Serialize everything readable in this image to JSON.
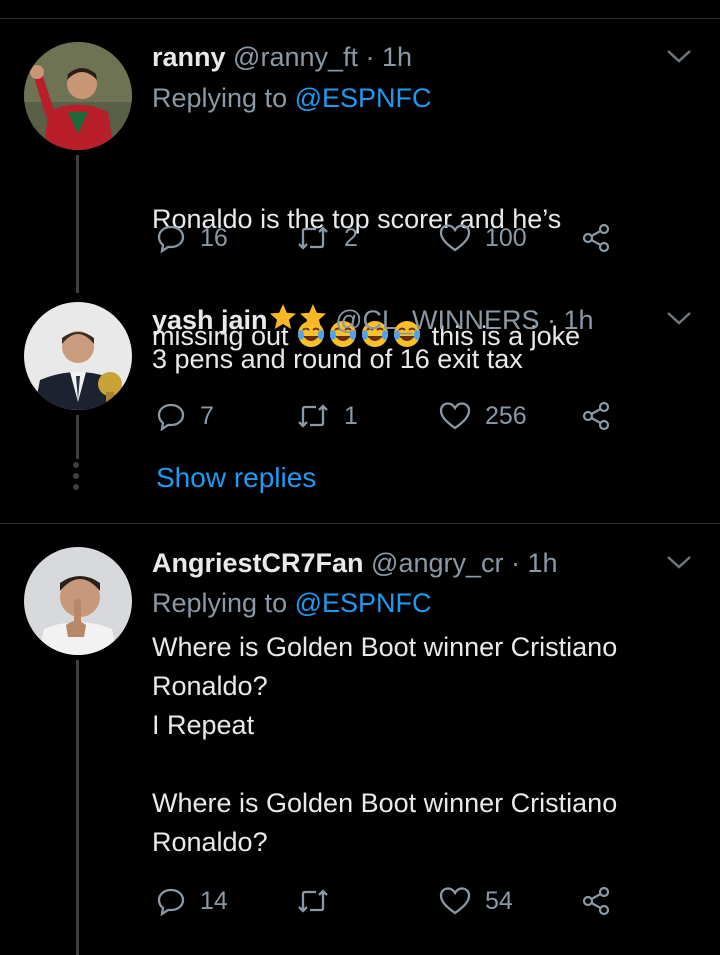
{
  "tweets": [
    {
      "name": "ranny",
      "handle": "@ranny_ft",
      "time": "· 1h",
      "replying_prefix": "Replying to",
      "replying_to": "@ESPNFC",
      "text_line1": "Ronaldo is the top scorer and he’s",
      "text_line2_before": "missing out",
      "text_line2_after": "this is a joke",
      "emoji": "face-with-tears-of-joy-icon x4",
      "replies": "16",
      "retweets": "2",
      "likes": "100"
    },
    {
      "name": "yash jain",
      "name_badges": "star-icon x2",
      "handle": "@CL_WINNERS",
      "time": "· 1h",
      "text": "3 pens and round of 16 exit tax",
      "replies": "7",
      "retweets": "1",
      "likes": "256",
      "show_replies": "Show replies"
    },
    {
      "name": "AngriestCR7Fan",
      "handle": "@angry_cr",
      "time": "· 1h",
      "replying_prefix": "Replying to",
      "replying_to": "@ESPNFC",
      "text": "Where is Golden Boot winner Cristiano\nRonaldo?\nI Repeat\n\nWhere is Golden Boot winner Cristiano\nRonaldo?",
      "replies": "14",
      "retweets": "",
      "likes": "54"
    }
  ],
  "colors": {
    "background": "#000000",
    "text": "#e7e9ea",
    "muted": "#8b98a5",
    "accent": "#1d9bf0",
    "divider": "#2f3336"
  }
}
